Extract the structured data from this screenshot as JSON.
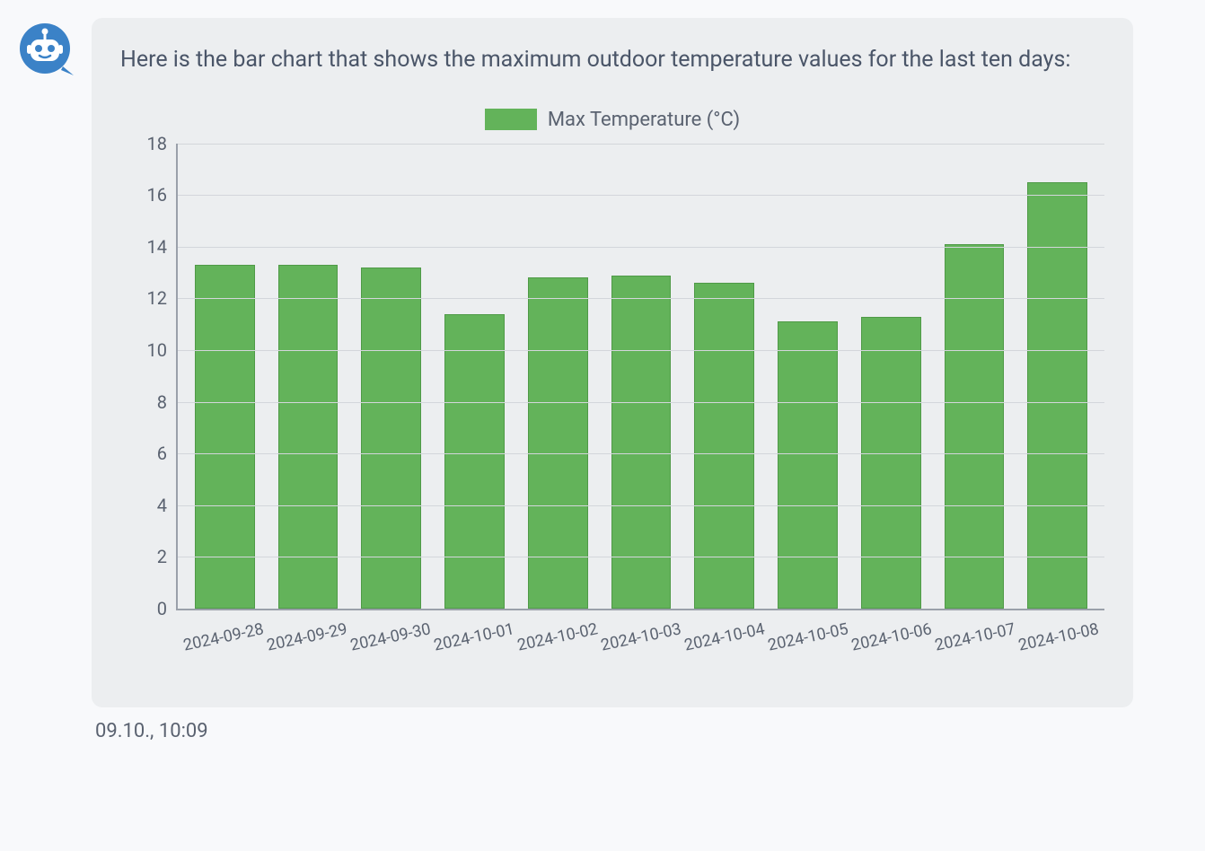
{
  "message": {
    "text": "Here is the bar chart that shows the maximum outdoor temperature values for the last ten days:",
    "timestamp": "09.10., 10:09"
  },
  "chart_data": {
    "type": "bar",
    "legend": "Max Temperature (°C)",
    "categories": [
      "2024-09-28",
      "2024-09-29",
      "2024-09-30",
      "2024-10-01",
      "2024-10-02",
      "2024-10-03",
      "2024-10-04",
      "2024-10-05",
      "2024-10-06",
      "2024-10-07",
      "2024-10-08"
    ],
    "values": [
      13.3,
      13.3,
      13.2,
      11.4,
      12.8,
      12.9,
      12.6,
      11.1,
      11.3,
      14.1,
      16.5
    ],
    "ylim": [
      0,
      18
    ],
    "yticks": [
      0,
      2,
      4,
      6,
      8,
      10,
      12,
      14,
      16,
      18
    ],
    "colors": {
      "bar": "#63b35a",
      "bar_border": "#4f9a47",
      "axis": "#9aa0aa",
      "grid": "#d3d6db",
      "text": "#5a6270"
    }
  }
}
